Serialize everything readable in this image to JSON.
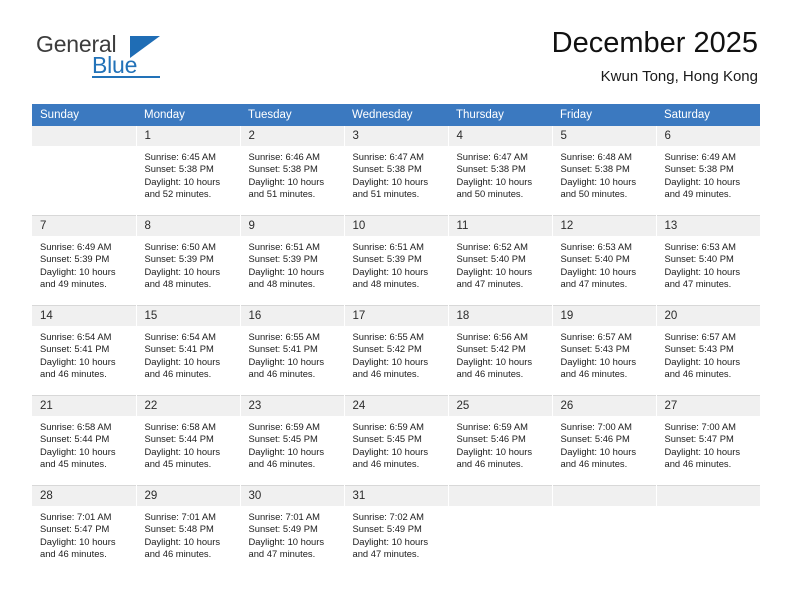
{
  "brand": {
    "name_top": "General",
    "name_bottom": "Blue",
    "logo_icon": "blue-triangle-icon"
  },
  "header": {
    "title": "December 2025",
    "subtitle": "Kwun Tong, Hong Kong",
    "accent_color": "#3b79c0",
    "daynum_band_color": "#f0f0f0"
  },
  "weekdays": [
    "Sunday",
    "Monday",
    "Tuesday",
    "Wednesday",
    "Thursday",
    "Friday",
    "Saturday"
  ],
  "weeks": [
    [
      {
        "empty": true
      },
      {
        "day": "1",
        "sunrise": "Sunrise: 6:45 AM",
        "sunset": "Sunset: 5:38 PM",
        "daylight": "Daylight: 10 hours and 52 minutes."
      },
      {
        "day": "2",
        "sunrise": "Sunrise: 6:46 AM",
        "sunset": "Sunset: 5:38 PM",
        "daylight": "Daylight: 10 hours and 51 minutes."
      },
      {
        "day": "3",
        "sunrise": "Sunrise: 6:47 AM",
        "sunset": "Sunset: 5:38 PM",
        "daylight": "Daylight: 10 hours and 51 minutes."
      },
      {
        "day": "4",
        "sunrise": "Sunrise: 6:47 AM",
        "sunset": "Sunset: 5:38 PM",
        "daylight": "Daylight: 10 hours and 50 minutes."
      },
      {
        "day": "5",
        "sunrise": "Sunrise: 6:48 AM",
        "sunset": "Sunset: 5:38 PM",
        "daylight": "Daylight: 10 hours and 50 minutes."
      },
      {
        "day": "6",
        "sunrise": "Sunrise: 6:49 AM",
        "sunset": "Sunset: 5:38 PM",
        "daylight": "Daylight: 10 hours and 49 minutes."
      }
    ],
    [
      {
        "day": "7",
        "sunrise": "Sunrise: 6:49 AM",
        "sunset": "Sunset: 5:39 PM",
        "daylight": "Daylight: 10 hours and 49 minutes."
      },
      {
        "day": "8",
        "sunrise": "Sunrise: 6:50 AM",
        "sunset": "Sunset: 5:39 PM",
        "daylight": "Daylight: 10 hours and 48 minutes."
      },
      {
        "day": "9",
        "sunrise": "Sunrise: 6:51 AM",
        "sunset": "Sunset: 5:39 PM",
        "daylight": "Daylight: 10 hours and 48 minutes."
      },
      {
        "day": "10",
        "sunrise": "Sunrise: 6:51 AM",
        "sunset": "Sunset: 5:39 PM",
        "daylight": "Daylight: 10 hours and 48 minutes."
      },
      {
        "day": "11",
        "sunrise": "Sunrise: 6:52 AM",
        "sunset": "Sunset: 5:40 PM",
        "daylight": "Daylight: 10 hours and 47 minutes."
      },
      {
        "day": "12",
        "sunrise": "Sunrise: 6:53 AM",
        "sunset": "Sunset: 5:40 PM",
        "daylight": "Daylight: 10 hours and 47 minutes."
      },
      {
        "day": "13",
        "sunrise": "Sunrise: 6:53 AM",
        "sunset": "Sunset: 5:40 PM",
        "daylight": "Daylight: 10 hours and 47 minutes."
      }
    ],
    [
      {
        "day": "14",
        "sunrise": "Sunrise: 6:54 AM",
        "sunset": "Sunset: 5:41 PM",
        "daylight": "Daylight: 10 hours and 46 minutes."
      },
      {
        "day": "15",
        "sunrise": "Sunrise: 6:54 AM",
        "sunset": "Sunset: 5:41 PM",
        "daylight": "Daylight: 10 hours and 46 minutes."
      },
      {
        "day": "16",
        "sunrise": "Sunrise: 6:55 AM",
        "sunset": "Sunset: 5:41 PM",
        "daylight": "Daylight: 10 hours and 46 minutes."
      },
      {
        "day": "17",
        "sunrise": "Sunrise: 6:55 AM",
        "sunset": "Sunset: 5:42 PM",
        "daylight": "Daylight: 10 hours and 46 minutes."
      },
      {
        "day": "18",
        "sunrise": "Sunrise: 6:56 AM",
        "sunset": "Sunset: 5:42 PM",
        "daylight": "Daylight: 10 hours and 46 minutes."
      },
      {
        "day": "19",
        "sunrise": "Sunrise: 6:57 AM",
        "sunset": "Sunset: 5:43 PM",
        "daylight": "Daylight: 10 hours and 46 minutes."
      },
      {
        "day": "20",
        "sunrise": "Sunrise: 6:57 AM",
        "sunset": "Sunset: 5:43 PM",
        "daylight": "Daylight: 10 hours and 46 minutes."
      }
    ],
    [
      {
        "day": "21",
        "sunrise": "Sunrise: 6:58 AM",
        "sunset": "Sunset: 5:44 PM",
        "daylight": "Daylight: 10 hours and 45 minutes."
      },
      {
        "day": "22",
        "sunrise": "Sunrise: 6:58 AM",
        "sunset": "Sunset: 5:44 PM",
        "daylight": "Daylight: 10 hours and 45 minutes."
      },
      {
        "day": "23",
        "sunrise": "Sunrise: 6:59 AM",
        "sunset": "Sunset: 5:45 PM",
        "daylight": "Daylight: 10 hours and 46 minutes."
      },
      {
        "day": "24",
        "sunrise": "Sunrise: 6:59 AM",
        "sunset": "Sunset: 5:45 PM",
        "daylight": "Daylight: 10 hours and 46 minutes."
      },
      {
        "day": "25",
        "sunrise": "Sunrise: 6:59 AM",
        "sunset": "Sunset: 5:46 PM",
        "daylight": "Daylight: 10 hours and 46 minutes."
      },
      {
        "day": "26",
        "sunrise": "Sunrise: 7:00 AM",
        "sunset": "Sunset: 5:46 PM",
        "daylight": "Daylight: 10 hours and 46 minutes."
      },
      {
        "day": "27",
        "sunrise": "Sunrise: 7:00 AM",
        "sunset": "Sunset: 5:47 PM",
        "daylight": "Daylight: 10 hours and 46 minutes."
      }
    ],
    [
      {
        "day": "28",
        "sunrise": "Sunrise: 7:01 AM",
        "sunset": "Sunset: 5:47 PM",
        "daylight": "Daylight: 10 hours and 46 minutes."
      },
      {
        "day": "29",
        "sunrise": "Sunrise: 7:01 AM",
        "sunset": "Sunset: 5:48 PM",
        "daylight": "Daylight: 10 hours and 46 minutes."
      },
      {
        "day": "30",
        "sunrise": "Sunrise: 7:01 AM",
        "sunset": "Sunset: 5:49 PM",
        "daylight": "Daylight: 10 hours and 47 minutes."
      },
      {
        "day": "31",
        "sunrise": "Sunrise: 7:02 AM",
        "sunset": "Sunset: 5:49 PM",
        "daylight": "Daylight: 10 hours and 47 minutes."
      },
      {
        "empty": true
      },
      {
        "empty": true
      },
      {
        "empty": true
      }
    ]
  ]
}
